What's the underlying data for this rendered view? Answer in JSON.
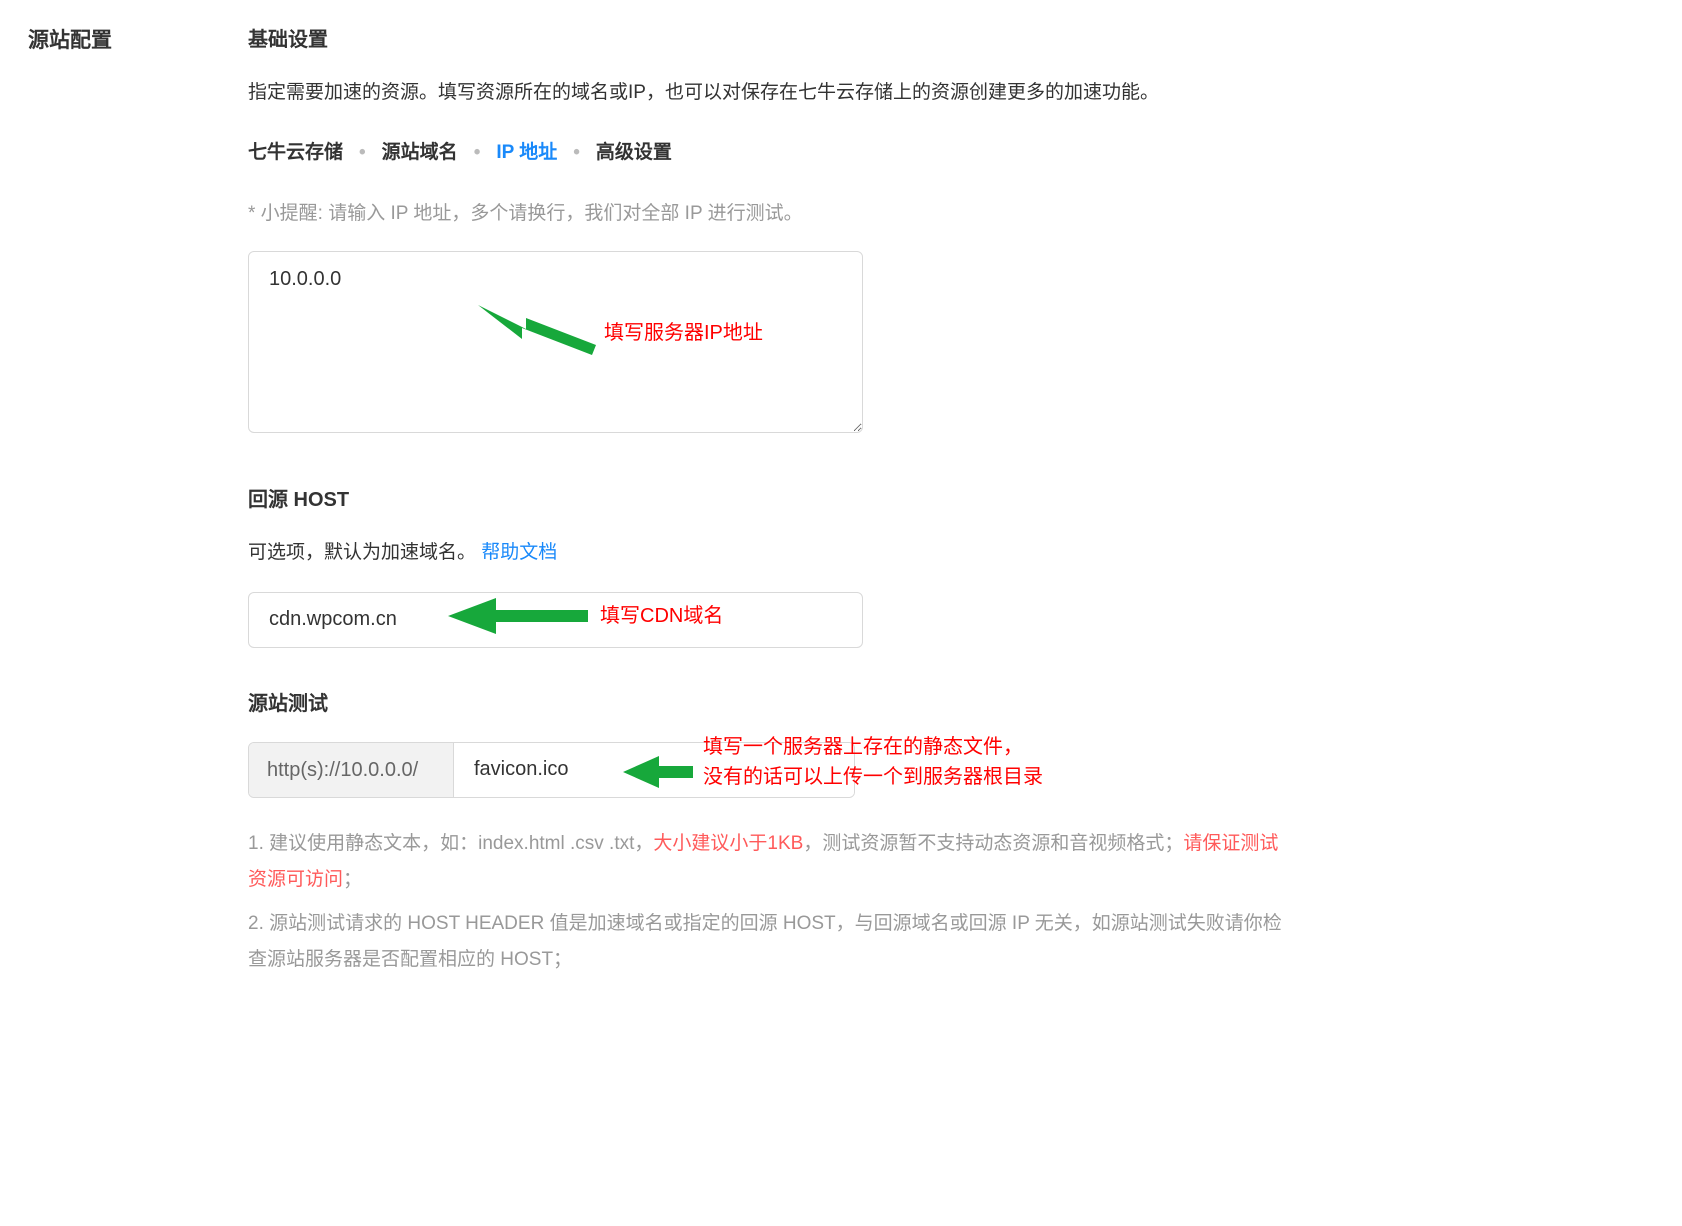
{
  "sidebar": {
    "title": "源站配置"
  },
  "basic": {
    "title": "基础设置",
    "desc": "指定需要加速的资源。填写资源所在的域名或IP，也可以对保存在七牛云存储上的资源创建更多的加速功能。"
  },
  "tabs": {
    "storage": "七牛云存储",
    "domain": "源站域名",
    "ip": "IP 地址",
    "advanced": "高级设置"
  },
  "ip": {
    "hint": "* 小提醒: 请输入 IP 地址，多个请换行，我们对全部 IP 进行测试。",
    "value": "10.0.0.0",
    "annot": "填写服务器IP地址"
  },
  "host": {
    "title": "回源 HOST",
    "desc_prefix": "可选项，默认为加速域名。 ",
    "help_link": "帮助文档",
    "value": "cdn.wpcom.cn",
    "annot": "填写CDN域名"
  },
  "test": {
    "title": "源站测试",
    "prefix": "http(s)://10.0.0.0/",
    "value": "favicon.ico",
    "annot_line1": "填写一个服务器上存在的静态文件，",
    "annot_line2": "没有的话可以上传一个到服务器根目录"
  },
  "notes": {
    "n1_a": "1. 建议使用静态文本，如：index.html .csv .txt，",
    "n1_red1": "大小建议小于1KB",
    "n1_b": "，测试资源暂不支持动态资源和音视频格式；",
    "n1_red2": "请保证测试资源可访问",
    "n1_c": "；",
    "n2": "2. 源站测试请求的 HOST HEADER 值是加速域名或指定的回源 HOST，与回源域名或回源 IP 无关，如源站测试失败请你检查源站服务器是否配置相应的 HOST；"
  }
}
